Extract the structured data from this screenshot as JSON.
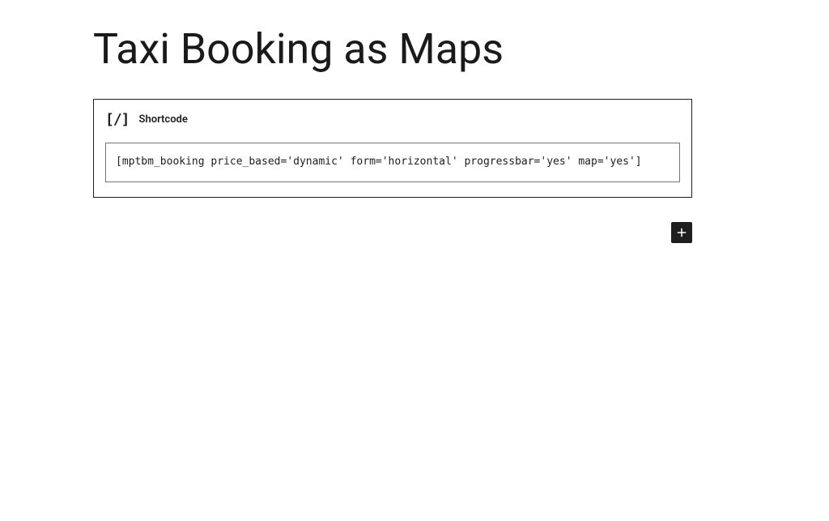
{
  "title": "Taxi Booking as Maps",
  "block": {
    "icon_text": "[/]",
    "label": "Shortcode",
    "value": "[mptbm_booking price_based='dynamic' form='horizontal' progressbar='yes' map='yes']"
  }
}
